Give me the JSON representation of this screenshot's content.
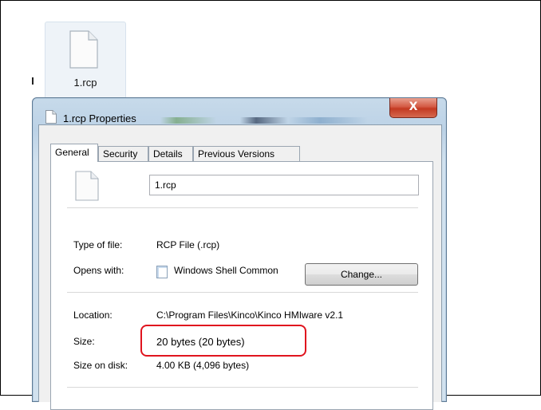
{
  "desktop": {
    "file_label": "1.rcp",
    "file_icon": "document-icon"
  },
  "window": {
    "title": "1.rcp Properties",
    "close_label": "X",
    "tabs": [
      {
        "label": "General",
        "active": true
      },
      {
        "label": "Security",
        "active": false
      },
      {
        "label": "Details",
        "active": false
      },
      {
        "label": "Previous Versions",
        "active": false
      }
    ],
    "general": {
      "filename_value": "1.rcp",
      "type_label": "Type of file:",
      "type_value": "RCP File (.rcp)",
      "opens_label": "Opens with:",
      "opens_value": "Windows Shell Common",
      "change_button": "Change...",
      "location_label": "Location:",
      "location_value": "C:\\Program Files\\Kinco\\Kinco HMIware v2.1",
      "size_label": "Size:",
      "size_value": "20 bytes (20 bytes)",
      "size_on_disk_label": "Size on disk:",
      "size_on_disk_value": "4.00 KB (4,096 bytes)"
    }
  },
  "colors": {
    "highlight": "#e0141e",
    "close_button": "#c33a22",
    "window_frame": "#bcd2e6"
  }
}
